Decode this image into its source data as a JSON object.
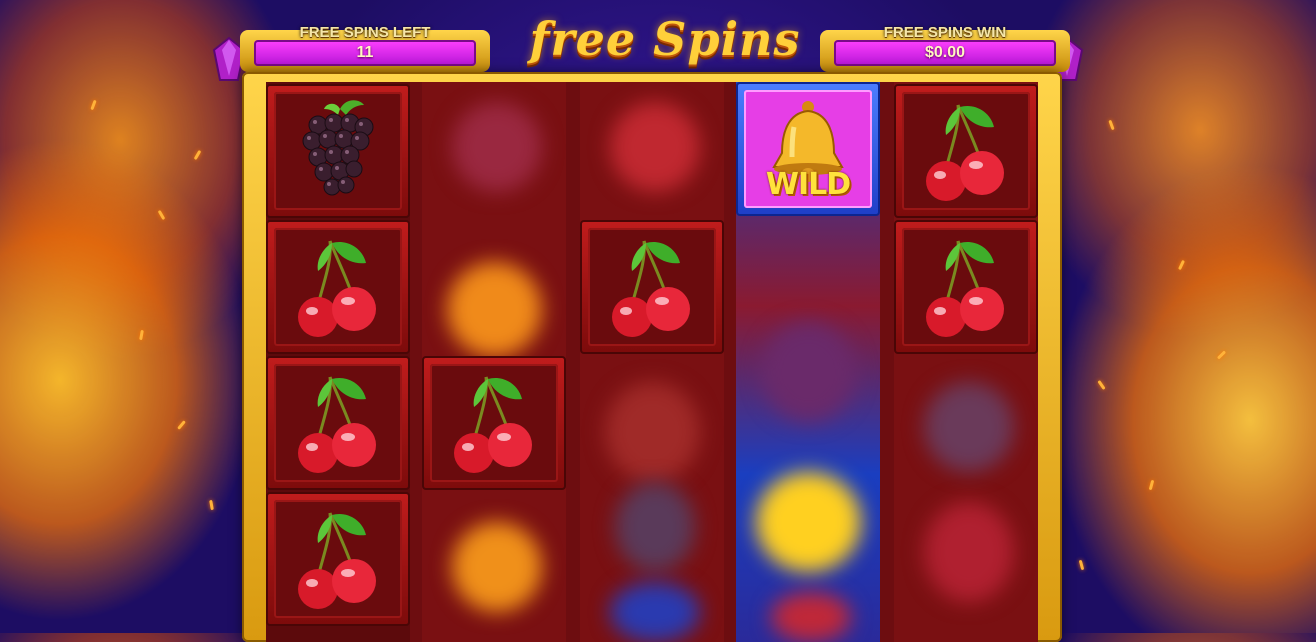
{
  "header": {
    "title": "free Spins",
    "free_spins_left": {
      "label": "FREE SPINS LEFT",
      "value": "11"
    },
    "free_spins_win": {
      "label": "FREE SPINS WIN",
      "value": "$0.00"
    }
  },
  "reels": [
    {
      "index": 1,
      "visible_symbols": [
        "grapes",
        "cherry",
        "cherry",
        "cherry"
      ],
      "state": "stopped"
    },
    {
      "index": 2,
      "visible_symbols": [
        "cherry"
      ],
      "state": "spinning"
    },
    {
      "index": 3,
      "visible_symbols": [
        "cherry"
      ],
      "state": "spinning"
    },
    {
      "index": 4,
      "visible_symbols": [
        "wild-bell"
      ],
      "state": "spinning"
    },
    {
      "index": 5,
      "visible_symbols": [
        "cherry",
        "cherry"
      ],
      "state": "spinning"
    }
  ],
  "symbols": {
    "wild_label": "WILD"
  },
  "colors": {
    "accent_gold": "#ffd54a",
    "panel_magenta": "#e63ee6",
    "reel_red": "#7a1012",
    "background_purple": "#2a1380"
  }
}
